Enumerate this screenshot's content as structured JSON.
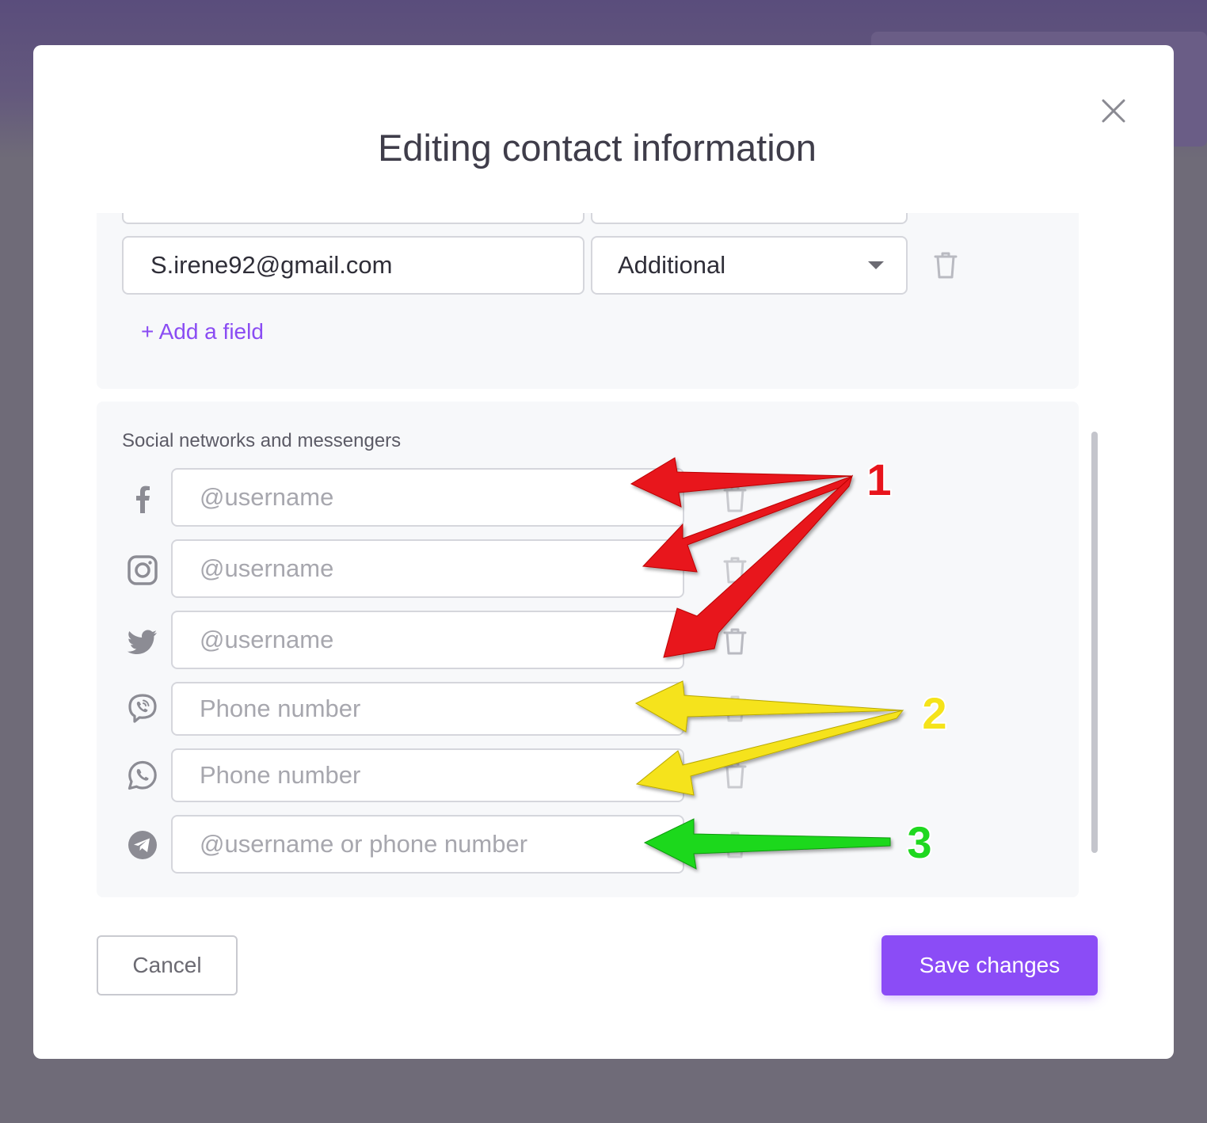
{
  "dialog": {
    "title": "Editing contact information",
    "close_icon": "close-icon"
  },
  "emails": {
    "rows": [
      {
        "value": "S.irene92@gmail.com",
        "type": "Additional"
      }
    ],
    "add_field_label": "+ Add a field"
  },
  "social": {
    "section_label": "Social networks and messengers",
    "networks": [
      {
        "icon": "facebook-icon",
        "placeholder": "@username"
      },
      {
        "icon": "instagram-icon",
        "placeholder": "@username"
      },
      {
        "icon": "twitter-icon",
        "placeholder": "@username"
      },
      {
        "icon": "viber-icon",
        "placeholder": "Phone number"
      },
      {
        "icon": "whatsapp-icon",
        "placeholder": "Phone number"
      },
      {
        "icon": "telegram-icon",
        "placeholder": "@username or phone number"
      }
    ]
  },
  "annotations": {
    "labels": [
      "1",
      "2",
      "3"
    ],
    "colors": [
      "#e8141c",
      "#f5e31a",
      "#1fd81f"
    ]
  },
  "footer": {
    "cancel_label": "Cancel",
    "save_label": "Save changes"
  },
  "colors": {
    "accent": "#8b4cf6",
    "panel_bg": "#f7f8fa",
    "backdrop": "#6f6b78"
  }
}
